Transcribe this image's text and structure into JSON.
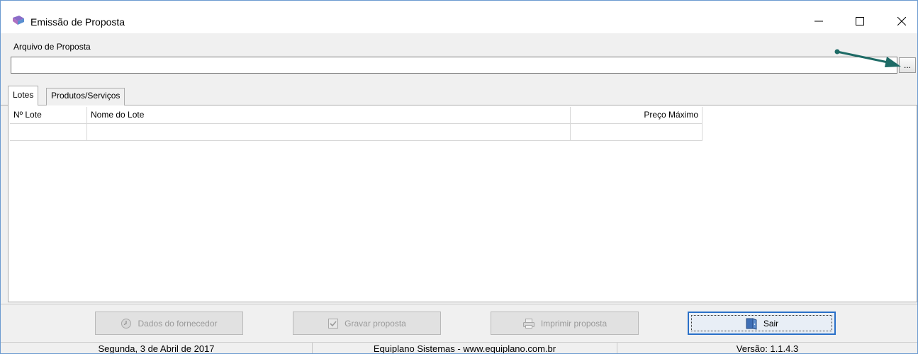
{
  "window": {
    "title": "Emissão de Proposta"
  },
  "proposal_file": {
    "label": "Arquivo de Proposta",
    "value": "",
    "browse_label": "..."
  },
  "tabs": [
    {
      "label": "Lotes",
      "active": true
    },
    {
      "label": "Produtos/Serviços",
      "active": false
    }
  ],
  "grid": {
    "columns": [
      "Nº Lote",
      "Nome do Lote",
      "Preço Máximo"
    ],
    "rows": [
      [
        "",
        "",
        ""
      ]
    ]
  },
  "actions": {
    "supplier_data": {
      "label": "Dados do fornecedor",
      "enabled": false
    },
    "save_proposal": {
      "label": "Gravar proposta",
      "enabled": false
    },
    "print_proposal": {
      "label": "Imprimir proposta",
      "enabled": false
    },
    "exit": {
      "label": "Sair",
      "enabled": true
    }
  },
  "status": {
    "date": "Segunda, 3 de Abril de 2017",
    "company": "Equiplano Sistemas - www.equiplano.com.br",
    "version": "Versão: 1.1.4.3"
  },
  "colors": {
    "annotation_arrow": "#1e6b66",
    "focus_border": "#2a70c8"
  },
  "icons": {
    "app": "book-icon",
    "supplier": "clock-icon",
    "save": "checkbox-icon",
    "print": "printer-icon",
    "exit": "door-exit-icon"
  }
}
